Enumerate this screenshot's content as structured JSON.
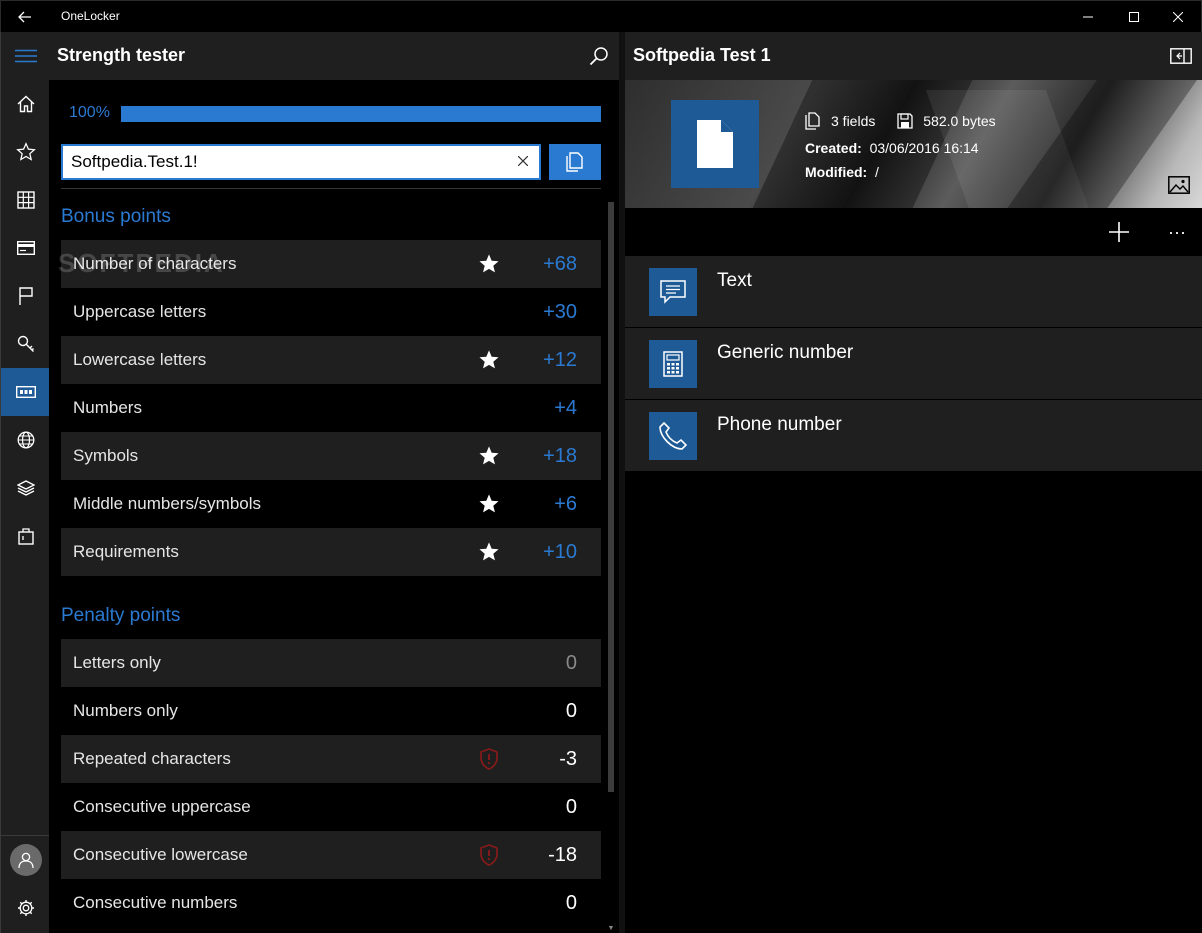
{
  "window": {
    "title": "OneLocker"
  },
  "strength": {
    "title": "Strength tester",
    "progress_label": "100%",
    "progress_value": 1.0,
    "password": "Softpedia.Test.1!",
    "bonus_title": "Bonus points",
    "bonus": [
      {
        "label": "Number of characters",
        "value": "+68",
        "star": true
      },
      {
        "label": "Uppercase letters",
        "value": "+30",
        "star": false
      },
      {
        "label": "Lowercase letters",
        "value": "+12",
        "star": true
      },
      {
        "label": "Numbers",
        "value": "+4",
        "star": false
      },
      {
        "label": "Symbols",
        "value": "+18",
        "star": true
      },
      {
        "label": "Middle numbers/symbols",
        "value": "+6",
        "star": true
      },
      {
        "label": "Requirements",
        "value": "+10",
        "star": true
      }
    ],
    "penalty_title": "Penalty points",
    "penalty": [
      {
        "label": "Letters only",
        "value": "0",
        "shield": false
      },
      {
        "label": "Numbers only",
        "value": "0",
        "shield": false
      },
      {
        "label": "Repeated characters",
        "value": "-3",
        "shield": true
      },
      {
        "label": "Consecutive uppercase",
        "value": "0",
        "shield": false
      },
      {
        "label": "Consecutive lowercase",
        "value": "-18",
        "shield": true
      },
      {
        "label": "Consecutive numbers",
        "value": "0",
        "shield": false
      }
    ]
  },
  "entry": {
    "title": "Softpedia Test 1",
    "fields_count": "3 fields",
    "size": "582.0 bytes",
    "created_label": "Created:",
    "created_value": "03/06/2016 16:14",
    "modified_label": "Modified:",
    "modified_value": "/",
    "fields": [
      {
        "label": "Text",
        "icon": "text-icon"
      },
      {
        "label": "Generic number",
        "icon": "calculator-icon"
      },
      {
        "label": "Phone number",
        "icon": "phone-icon"
      }
    ]
  },
  "colors": {
    "accent": "#2b7ad1",
    "tile": "#1e5a96",
    "panel": "#1f1f1f",
    "penalty_icon": "#8b1a1a"
  }
}
